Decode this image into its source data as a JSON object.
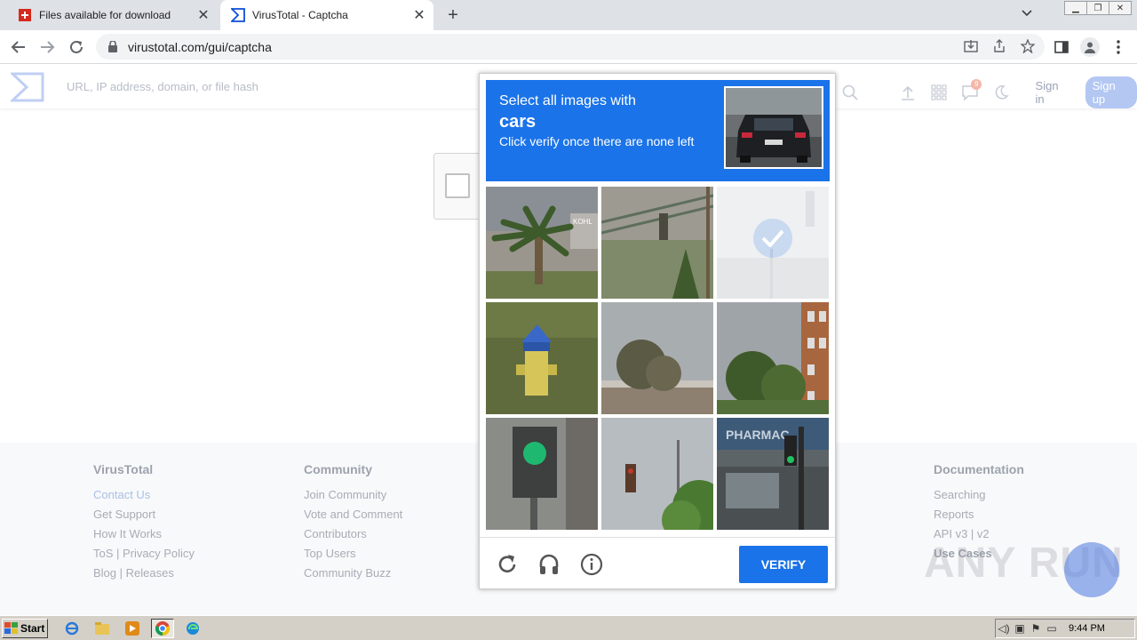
{
  "browser": {
    "tabs": [
      {
        "title": "Files available for download",
        "favicon": "swiss-flag-icon",
        "active": false
      },
      {
        "title": "VirusTotal - Captcha",
        "favicon": "virustotal-icon",
        "active": true
      }
    ],
    "url": "virustotal.com/gui/captcha",
    "tab_close": "✕",
    "new_tab": "+"
  },
  "vt": {
    "search_placeholder": "URL, IP address, domain, or file hash",
    "notification_count": "9",
    "signin": "Sign in",
    "signup": "Sign up",
    "brand_color": "#0b4dda"
  },
  "footer": {
    "columns": [
      {
        "title": "VirusTotal",
        "links": [
          "Contact Us",
          "Get Support",
          "How It Works",
          "ToS | Privacy Policy",
          "Blog | Releases"
        ]
      },
      {
        "title": "Community",
        "links": [
          "Join Community",
          "Vote and Comment",
          "Contributors",
          "Top Users",
          "Community Buzz"
        ]
      },
      {
        "title": "Documentation",
        "links": [
          "Searching",
          "Reports",
          "API v3 | v2",
          "Use Cases"
        ]
      }
    ]
  },
  "captcha": {
    "line1": "Select all images with",
    "keyword": "cars",
    "line3": "Click verify once there are none left",
    "verify_label": "VERIFY",
    "header_color": "#1a73e8",
    "tiles": [
      {
        "desc": "palm tree",
        "selected": false
      },
      {
        "desc": "railing and grass",
        "selected": false
      },
      {
        "desc": "traffic light faded",
        "selected": true
      },
      {
        "desc": "fire hydrant",
        "selected": false
      },
      {
        "desc": "trees and roof",
        "selected": false
      },
      {
        "desc": "building with trees",
        "selected": false
      },
      {
        "desc": "traffic light green",
        "selected": false
      },
      {
        "desc": "traffic light pole",
        "selected": false
      },
      {
        "desc": "pharmacy storefront",
        "selected": false
      }
    ],
    "storefront_text": "PHARMAC",
    "sign_text": "KOHL"
  },
  "watermark": "ANY RUN",
  "taskbar": {
    "start_label": "Start",
    "clock": "9:44 PM"
  }
}
